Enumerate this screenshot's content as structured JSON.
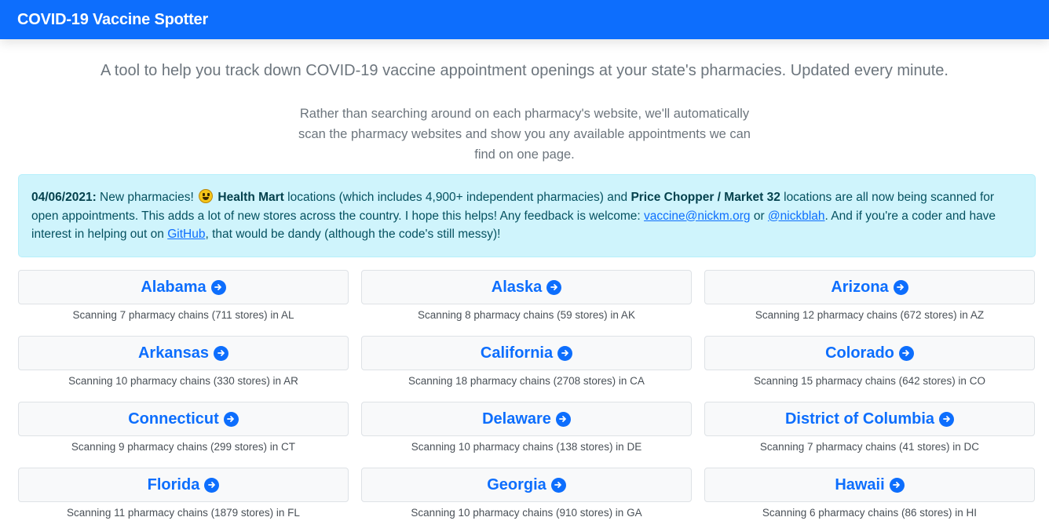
{
  "navbar": {
    "brand": "COVID-19 Vaccine Spotter"
  },
  "intro": {
    "lead": "A tool to help you track down COVID-19 vaccine appointment openings at your state's pharmacies. Updated every minute.",
    "sub": "Rather than searching around on each pharmacy's website, we'll automatically scan the pharmacy websites and show you any available appointments we can find on one page."
  },
  "alert": {
    "date": "04/06/2021:",
    "t1": " New pharmacies! ",
    "emoji": "grinning-face",
    "b1": "Health Mart",
    "t2": " locations (which includes 4,900+ independent pharmacies) and ",
    "b2": "Price Chopper / Market 32",
    "t3": " locations are all now being scanned for open appointments. This adds a lot of new stores across the country. I hope this helps! Any feedback is welcome: ",
    "email": "vaccine@nickm.org",
    "t4": " or ",
    "twitter": "@nickblah",
    "t5": ". And if you're a coder and have interest in helping out on ",
    "github": "GitHub",
    "t6": ", that would be dandy (although the code's still messy)!"
  },
  "states": [
    {
      "name": "Alabama",
      "scan": "Scanning 7 pharmacy chains (711 stores) in AL"
    },
    {
      "name": "Alaska",
      "scan": "Scanning 8 pharmacy chains (59 stores) in AK"
    },
    {
      "name": "Arizona",
      "scan": "Scanning 12 pharmacy chains (672 stores) in AZ"
    },
    {
      "name": "Arkansas",
      "scan": "Scanning 10 pharmacy chains (330 stores) in AR"
    },
    {
      "name": "California",
      "scan": "Scanning 18 pharmacy chains (2708 stores) in CA"
    },
    {
      "name": "Colorado",
      "scan": "Scanning 15 pharmacy chains (642 stores) in CO"
    },
    {
      "name": "Connecticut",
      "scan": "Scanning 9 pharmacy chains (299 stores) in CT"
    },
    {
      "name": "Delaware",
      "scan": "Scanning 10 pharmacy chains (138 stores) in DE"
    },
    {
      "name": "District of Columbia",
      "scan": "Scanning 7 pharmacy chains (41 stores) in DC"
    },
    {
      "name": "Florida",
      "scan": "Scanning 11 pharmacy chains (1879 stores) in FL"
    },
    {
      "name": "Georgia",
      "scan": "Scanning 10 pharmacy chains (910 stores) in GA"
    },
    {
      "name": "Hawaii",
      "scan": "Scanning 6 pharmacy chains (86 stores) in HI"
    }
  ],
  "colors": {
    "primary": "#0d6efd",
    "alert_bg": "#cff4fc",
    "alert_text": "#055160",
    "muted": "#6c757d"
  },
  "icons": {
    "state_arrow": "arrow-right-circle-icon"
  }
}
